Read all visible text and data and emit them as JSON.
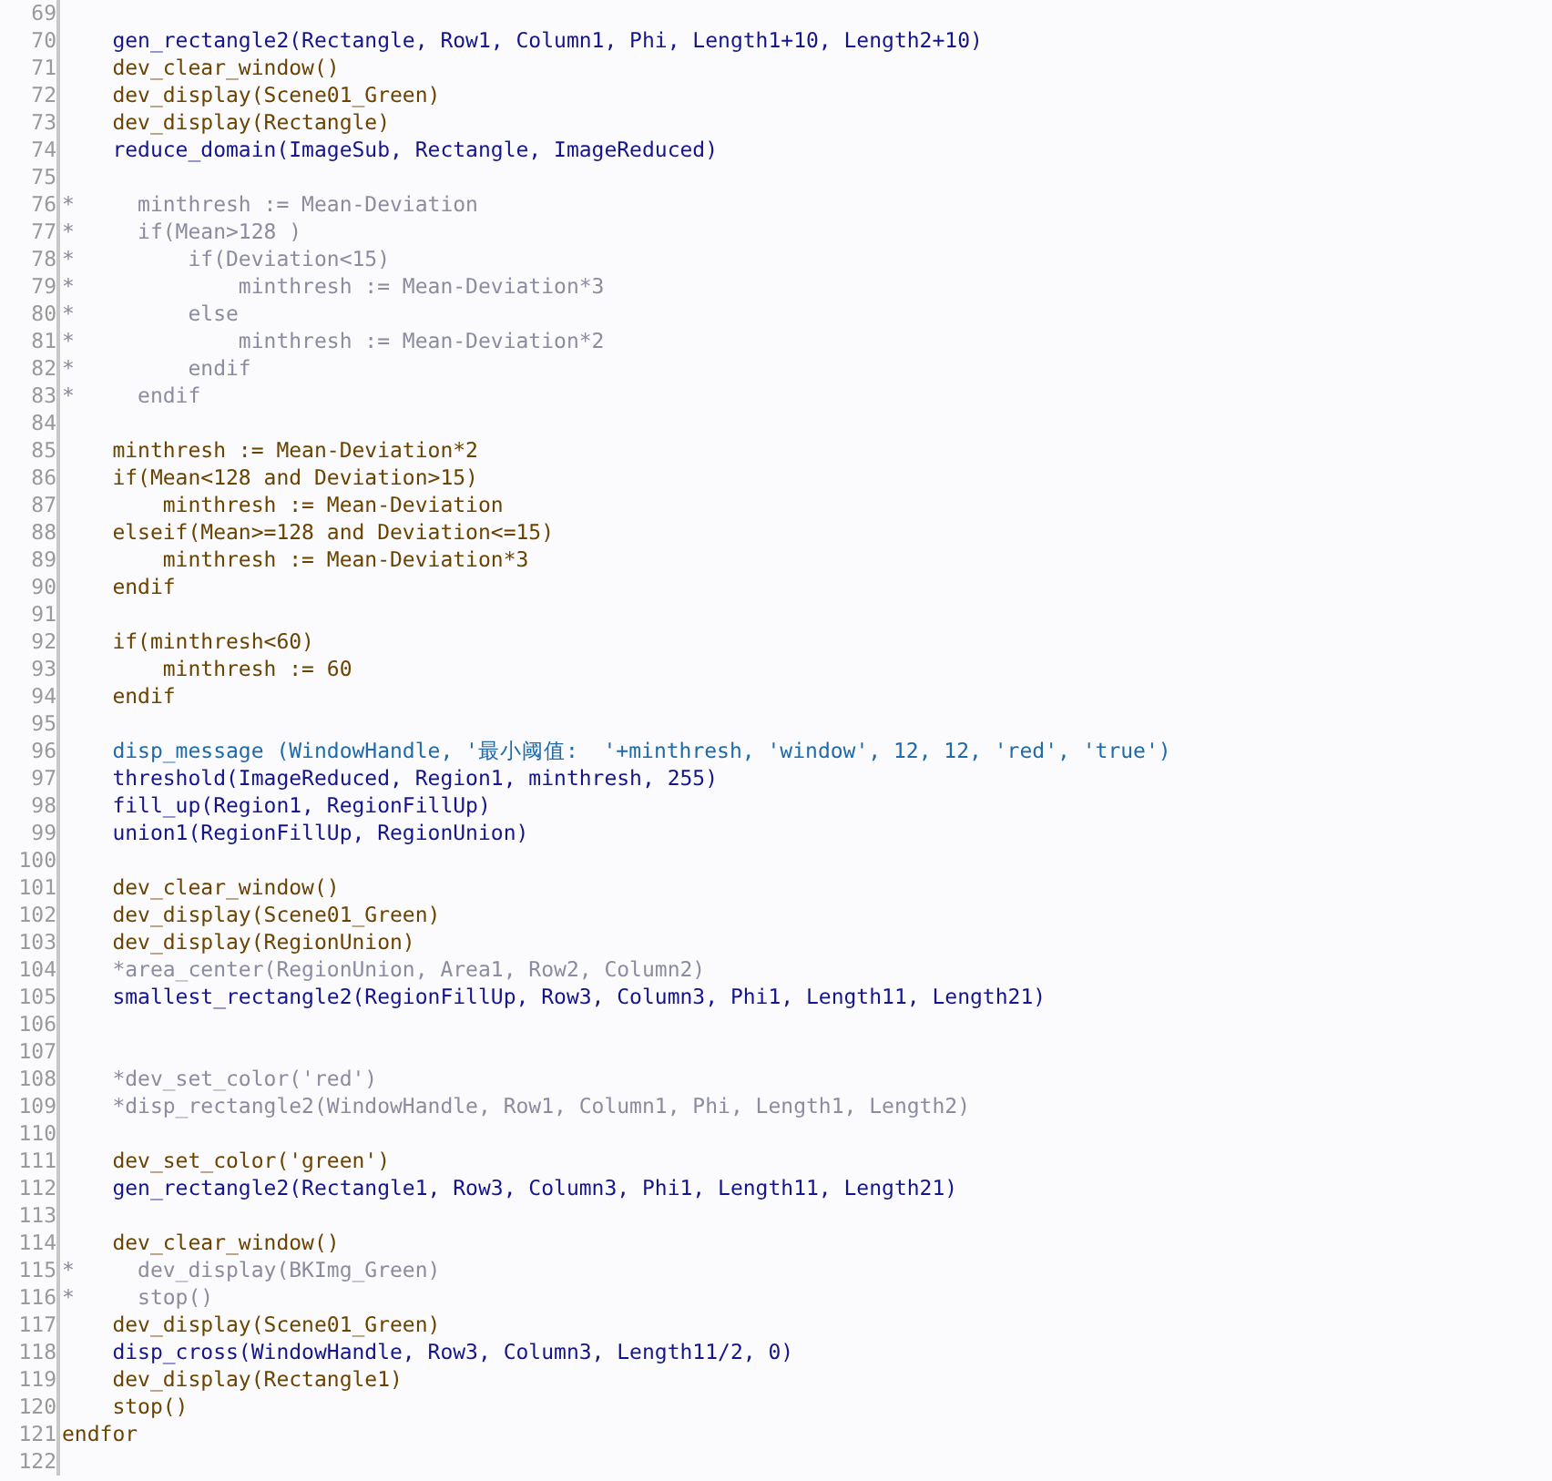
{
  "editor": {
    "lines": [
      {
        "number": "69"
      },
      {
        "number": "70",
        "kind": "operator",
        "text": "    gen_rectangle2(Rectangle, Row1, Column1, Phi, Length1+10, Length2+10)"
      },
      {
        "number": "71",
        "kind": "control",
        "text": "    dev_clear_window()"
      },
      {
        "number": "72",
        "kind": "control",
        "text": "    dev_display(Scene01_Green)"
      },
      {
        "number": "73",
        "kind": "control",
        "text": "    dev_display(Rectangle)"
      },
      {
        "number": "74",
        "kind": "operator",
        "text": "    reduce_domain(ImageSub, Rectangle, ImageReduced)"
      },
      {
        "number": "75"
      },
      {
        "number": "76",
        "kind": "comment",
        "mark": "*",
        "text": "     minthresh := Mean-Deviation"
      },
      {
        "number": "77",
        "kind": "comment",
        "mark": "*",
        "text": "     if(Mean>128 )"
      },
      {
        "number": "78",
        "kind": "comment",
        "mark": "*",
        "text": "         if(Deviation<15)"
      },
      {
        "number": "79",
        "kind": "comment",
        "mark": "*",
        "text": "             minthresh := Mean-Deviation*3"
      },
      {
        "number": "80",
        "kind": "comment",
        "mark": "*",
        "text": "         else"
      },
      {
        "number": "81",
        "kind": "comment",
        "mark": "*",
        "text": "             minthresh := Mean-Deviation*2"
      },
      {
        "number": "82",
        "kind": "comment",
        "mark": "*",
        "text": "         endif"
      },
      {
        "number": "83",
        "kind": "comment",
        "mark": "*",
        "text": "     endif"
      },
      {
        "number": "84"
      },
      {
        "number": "85",
        "kind": "control",
        "text": "    minthresh := Mean-Deviation*2"
      },
      {
        "number": "86",
        "kind": "control",
        "text": "    if(Mean<128 and Deviation>15)"
      },
      {
        "number": "87",
        "kind": "control",
        "text": "        minthresh := Mean-Deviation"
      },
      {
        "number": "88",
        "kind": "control",
        "text": "    elseif(Mean>=128 and Deviation<=15)"
      },
      {
        "number": "89",
        "kind": "control",
        "text": "        minthresh := Mean-Deviation*3"
      },
      {
        "number": "90",
        "kind": "control",
        "text": "    endif"
      },
      {
        "number": "91"
      },
      {
        "number": "92",
        "kind": "control",
        "text": "    if(minthresh<60)"
      },
      {
        "number": "93",
        "kind": "control",
        "text": "        minthresh := 60"
      },
      {
        "number": "94",
        "kind": "control",
        "text": "    endif"
      },
      {
        "number": "95"
      },
      {
        "number": "96",
        "kind": "message",
        "text": "    disp_message (WindowHandle, '最小阈值:  '+minthresh, 'window', 12, 12, 'red', 'true')"
      },
      {
        "number": "97",
        "kind": "operator",
        "text": "    threshold(ImageReduced, Region1, minthresh, 255)"
      },
      {
        "number": "98",
        "kind": "operator",
        "text": "    fill_up(Region1, RegionFillUp)"
      },
      {
        "number": "99",
        "kind": "operator",
        "text": "    union1(RegionFillUp, RegionUnion)"
      },
      {
        "number": "100"
      },
      {
        "number": "101",
        "kind": "control",
        "text": "    dev_clear_window()"
      },
      {
        "number": "102",
        "kind": "control",
        "text": "    dev_display(Scene01_Green)"
      },
      {
        "number": "103",
        "kind": "control",
        "text": "    dev_display(RegionUnion)"
      },
      {
        "number": "104",
        "kind": "comment",
        "text": "    *area_center(RegionUnion, Area1, Row2, Column2)"
      },
      {
        "number": "105",
        "kind": "operator",
        "text": "    smallest_rectangle2(RegionFillUp, Row3, Column3, Phi1, Length11, Length21)"
      },
      {
        "number": "106"
      },
      {
        "number": "107"
      },
      {
        "number": "108",
        "kind": "comment",
        "text": "    *dev_set_color('red')"
      },
      {
        "number": "109",
        "kind": "comment",
        "text": "    *disp_rectangle2(WindowHandle, Row1, Column1, Phi, Length1, Length2)"
      },
      {
        "number": "110"
      },
      {
        "number": "111",
        "kind": "control",
        "text": "    dev_set_color('green')"
      },
      {
        "number": "112",
        "kind": "operator",
        "text": "    gen_rectangle2(Rectangle1, Row3, Column3, Phi1, Length11, Length21)"
      },
      {
        "number": "113"
      },
      {
        "number": "114",
        "kind": "control",
        "text": "    dev_clear_window()"
      },
      {
        "number": "115",
        "kind": "comment",
        "mark": "*",
        "text": "     dev_display(BKImg_Green)"
      },
      {
        "number": "116",
        "kind": "comment",
        "mark": "*",
        "text": "     stop()"
      },
      {
        "number": "117",
        "kind": "control",
        "text": "    dev_display(Scene01_Green)"
      },
      {
        "number": "118",
        "kind": "operator",
        "text": "    disp_cross(WindowHandle, Row3, Column3, Length11/2, 0)"
      },
      {
        "number": "119",
        "kind": "control",
        "text": "    dev_display(Rectangle1)"
      },
      {
        "number": "120",
        "kind": "control",
        "text": "    stop()"
      },
      {
        "number": "121",
        "kind": "control",
        "text": "endfor"
      },
      {
        "number": "122"
      }
    ]
  }
}
